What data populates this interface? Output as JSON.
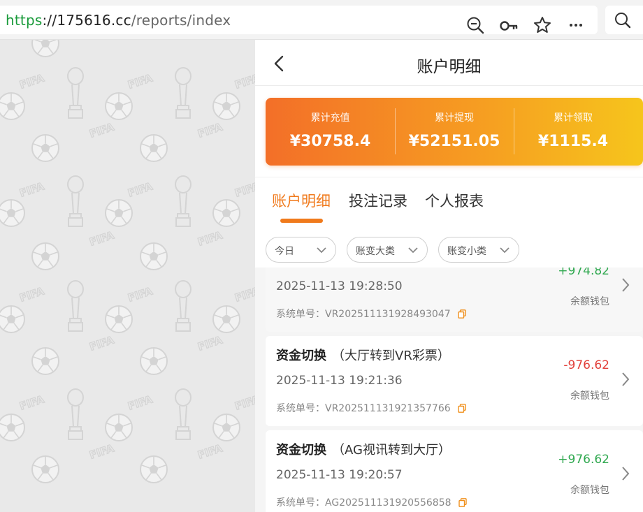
{
  "browser": {
    "url_proto": "https",
    "url_sep": "://",
    "url_host": "175616.cc",
    "url_path": "/reports/index",
    "icons": [
      "zoom-out-icon",
      "key-icon",
      "star-icon",
      "more-icon",
      "search-icon"
    ]
  },
  "header": {
    "title": "账户明细"
  },
  "summary": [
    {
      "label": "累计充值",
      "value": "¥30758.4"
    },
    {
      "label": "累计提现",
      "value": "¥52151.05"
    },
    {
      "label": "累计领取",
      "value": "¥1115.4"
    }
  ],
  "tabs": [
    {
      "label": "账户明细",
      "active": true
    },
    {
      "label": "投注记录",
      "active": false
    },
    {
      "label": "个人报表",
      "active": false
    }
  ],
  "filters": [
    {
      "label": "今日"
    },
    {
      "label": "账变大类"
    },
    {
      "label": "账变小类"
    }
  ],
  "records": [
    {
      "title": "",
      "subtitle": "",
      "time": "2025-11-13 19:28:50",
      "order_label": "系统单号：",
      "order_no": "VR20251113192849304​7",
      "amount": "+974.82",
      "sign": "pos",
      "wallet": "余额钱包"
    },
    {
      "title": "资金切换",
      "subtitle": "（大厅转到VR彩票）",
      "time": "2025-11-13 19:21:36",
      "order_label": "系统单号：",
      "order_no": "VR202511131921357766",
      "amount": "-976.62",
      "sign": "neg",
      "wallet": "余额钱包"
    },
    {
      "title": "资金切换",
      "subtitle": "（AG视讯转到大厅）",
      "time": "2025-11-13 19:20:57",
      "order_label": "系统单号：",
      "order_no": "AG202511131920556858",
      "amount": "+976.62",
      "sign": "pos",
      "wallet": "余额钱包"
    }
  ],
  "colors": {
    "accent": "#f07a1c",
    "positive": "#2fa84f",
    "negative": "#e2403a",
    "gradient_start": "#f36f28",
    "gradient_end": "#f6c51c"
  }
}
